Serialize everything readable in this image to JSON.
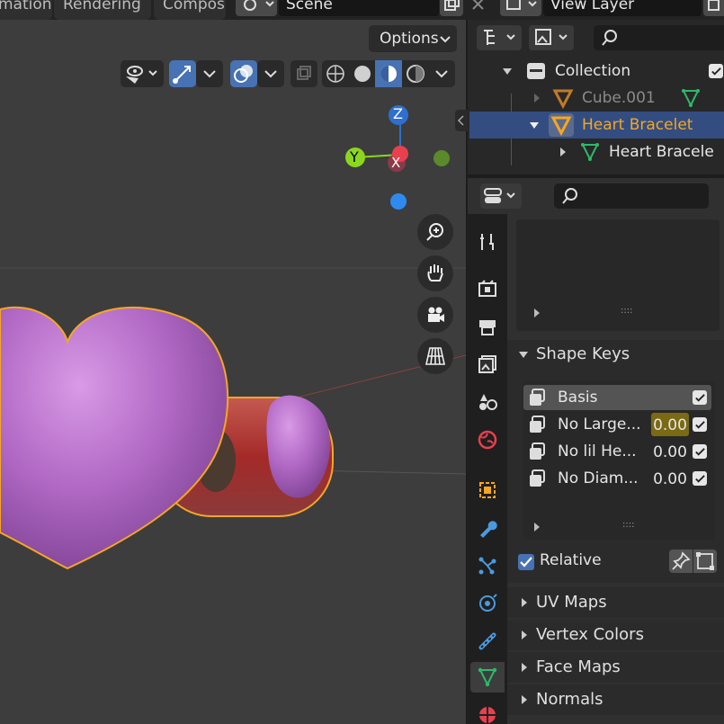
{
  "topbar": {
    "tabs": [
      "mation",
      "Rendering",
      "Compos"
    ],
    "scene_label": "Scene",
    "view_layer_label": "View Layer"
  },
  "viewport": {
    "options_label": "Options",
    "gizmo": {
      "z": "Z",
      "y": "Y",
      "x": "X"
    }
  },
  "outliner": {
    "rows": [
      {
        "label": "Collection"
      },
      {
        "label": "Cube.001"
      },
      {
        "label": "Heart Bracelet"
      },
      {
        "label": "Heart Bracele"
      }
    ]
  },
  "properties": {
    "shape_keys_title": "Shape Keys",
    "keys": [
      {
        "name": "Basis",
        "value": ""
      },
      {
        "name": "No Large...",
        "value": "0.00"
      },
      {
        "name": "No lil He...",
        "value": "0.00"
      },
      {
        "name": "No Diam...",
        "value": "0.00"
      }
    ],
    "relative_label": "Relative",
    "panels": [
      "UV Maps",
      "Vertex Colors",
      "Face Maps",
      "Normals"
    ],
    "grip": "::::"
  },
  "colors": {
    "accent_blue": "#4772b3",
    "selected_row": "#334d80",
    "orange": "#f5a623",
    "value_highlight": "#7a6a14",
    "axis_x": "#e8404e",
    "axis_y": "#8bd61e",
    "axis_z": "#2f6fcf"
  }
}
